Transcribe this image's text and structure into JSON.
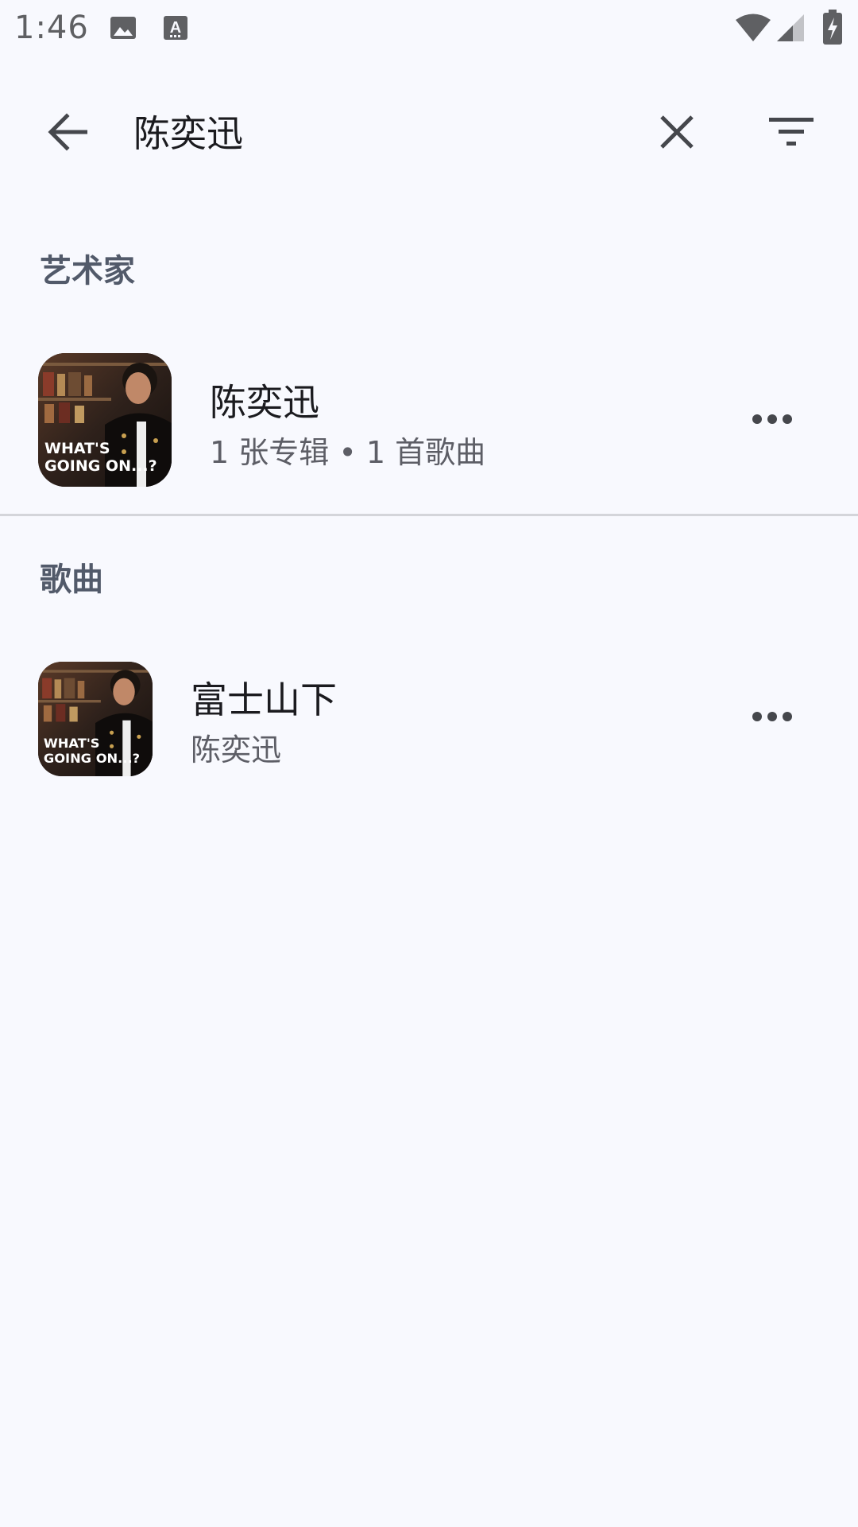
{
  "status_bar": {
    "time": "1:46",
    "icons": [
      "image-icon",
      "text-a-icon",
      "wifi-icon",
      "signal-icon",
      "battery-charging-icon"
    ]
  },
  "search": {
    "query": "陈奕迅",
    "icons": {
      "back": "arrow-left-icon",
      "clear": "close-icon",
      "filter": "filter-icon"
    }
  },
  "sections": {
    "artists": {
      "header": "艺术家",
      "items": [
        {
          "title": "陈奕迅",
          "subtitle": "1 张专辑 • 1 首歌曲",
          "art_text": [
            "WHAT'S",
            "GOING ON...?"
          ]
        }
      ]
    },
    "songs": {
      "header": "歌曲",
      "items": [
        {
          "title": "富士山下",
          "subtitle": "陈奕迅",
          "art_text": [
            "WHAT'S",
            "GOING ON...?"
          ]
        }
      ]
    }
  },
  "colors": {
    "background": "#f8f9fe",
    "section_header": "#525a6a",
    "divider": "#d4d5da",
    "icon": "#45474c"
  }
}
